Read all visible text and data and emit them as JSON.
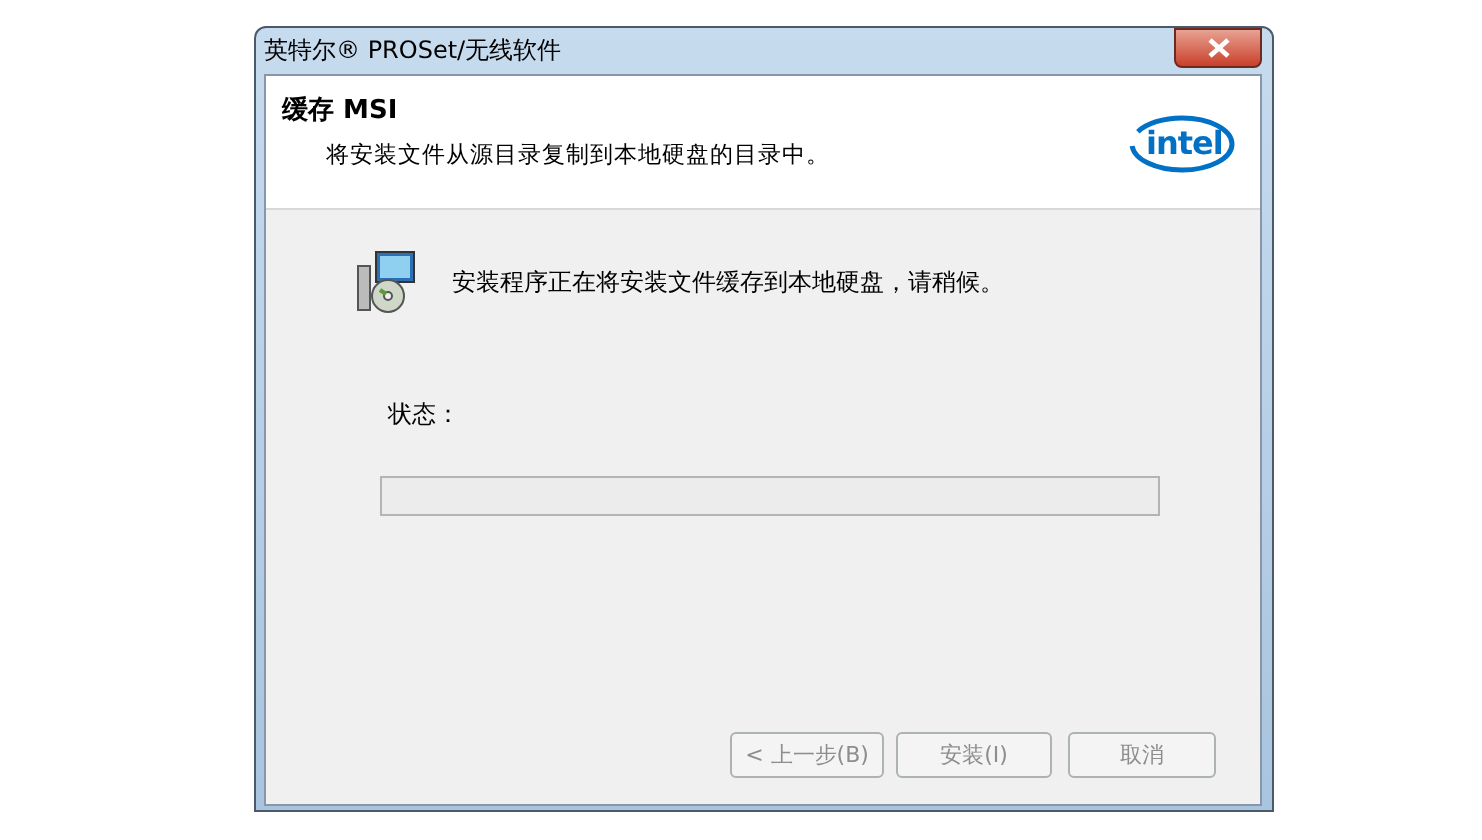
{
  "window": {
    "title": "英特尔® PROSet/无线软件"
  },
  "header": {
    "title": "缓存 MSI",
    "logo": "intel",
    "subtitle": "将安装文件从源目录复制到本地硬盘的目录中。"
  },
  "message": "安装程序正在将安装文件缓存到本地硬盘，请稍候。",
  "status": {
    "label": "状态：",
    "level": 0
  },
  "buttons": [
    {
      "label": "< 上一步(B)",
      "disabled": true
    },
    {
      "label": "安装(I)",
      "disabled": true
    },
    {
      "label": "取消",
      "disabled": true
    }
  ]
}
